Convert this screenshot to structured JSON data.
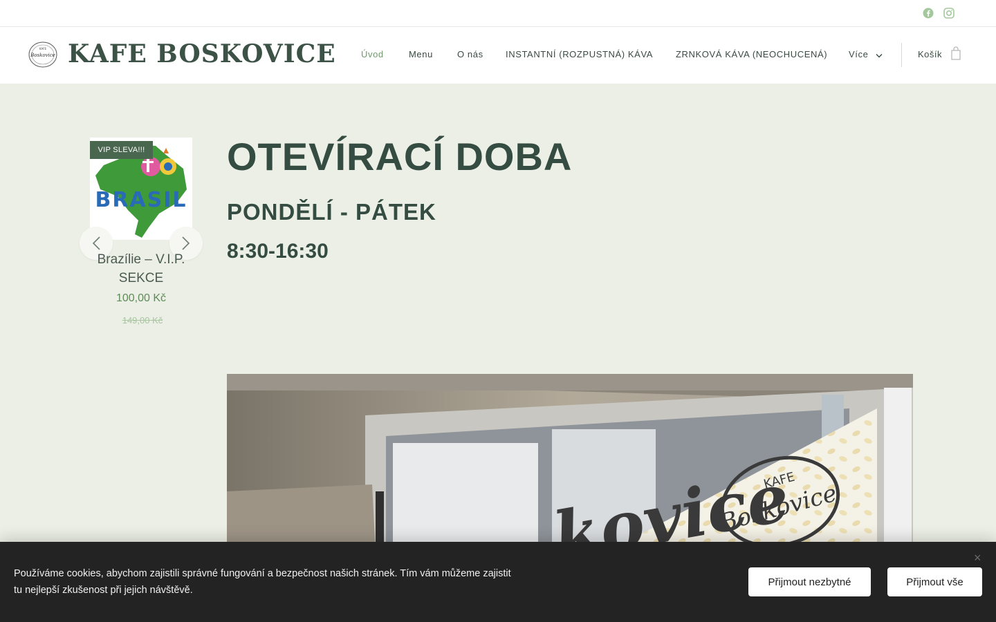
{
  "social": {
    "facebook_icon": "facebook-icon",
    "instagram_icon": "instagram-icon",
    "color": "#a3c89b"
  },
  "header": {
    "logo_text": "KAFE BOSKOVICE",
    "logo_badge_text": "Boskovice",
    "nav": [
      {
        "label": "Úvod",
        "active": true
      },
      {
        "label": "Menu"
      },
      {
        "label": "O nás"
      },
      {
        "label": "INSTANTNÍ (ROZPUSTNÁ) KÁVA"
      },
      {
        "label": "ZRNKOVÁ KÁVA (NEOCHUCENÁ)"
      },
      {
        "label": "Více"
      }
    ],
    "cart_label": "Košík"
  },
  "product": {
    "badge": "VIP SLEVA!!!",
    "image_text": "BRASIL",
    "name": "Brazílie – V.I.P. SEKCE",
    "price": "100,00 Kč",
    "old_price": "149,00 Kč"
  },
  "main": {
    "title": "OTEVÍRACÍ DOBA",
    "days": "PONDĚLÍ - PÁTEK",
    "hours": "8:30-16:30"
  },
  "photo": {
    "sign_text_large": "kovice",
    "sign_logo_top": "KAFE",
    "sign_logo_bottom": "Boskovice"
  },
  "cookie": {
    "text": "Používáme cookies, abychom zajistili správné fungování a bezpečnost našich stránek. Tím vám můžeme zajistit tu nejlepší zkušenost při jejich návštěvě.",
    "necessary_label": "Přijmout nezbytné",
    "all_label": "Přijmout vše"
  },
  "colors": {
    "accent": "#6f9a6a",
    "background": "#ecefe5",
    "dark_green": "#344c42",
    "badge": "#49664f"
  }
}
